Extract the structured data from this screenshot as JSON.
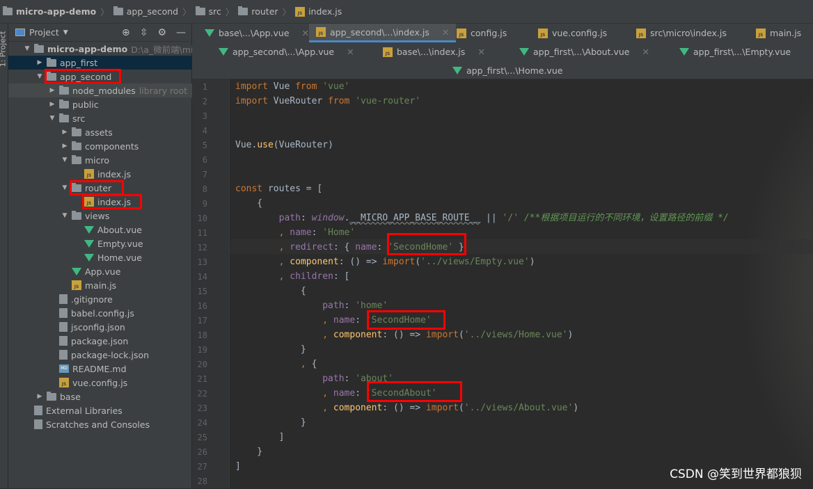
{
  "breadcrumb": [
    {
      "label": "micro-app-demo",
      "icon": "folder"
    },
    {
      "label": "app_second",
      "icon": "folder"
    },
    {
      "label": "src",
      "icon": "folder"
    },
    {
      "label": "router",
      "icon": "folder"
    },
    {
      "label": "index.js",
      "icon": "js"
    }
  ],
  "side_stripe": {
    "label": "1: Project"
  },
  "project_panel": {
    "title": "Project",
    "tools": [
      "crosshair-icon",
      "collapse-icon",
      "gear-icon",
      "minimize-icon"
    ]
  },
  "tree": [
    {
      "label": "micro-app-demo",
      "level": 0,
      "arrow": "down",
      "icon": "folder",
      "bold": true,
      "extra": "D:\\a_微前端\\micro-a"
    },
    {
      "label": "app_first",
      "level": 1,
      "arrow": "right",
      "icon": "folder",
      "selected": true
    },
    {
      "label": "app_second",
      "level": 1,
      "arrow": "down",
      "icon": "folder",
      "boxed": true
    },
    {
      "label": "node_modules",
      "level": 2,
      "arrow": "right",
      "icon": "folder",
      "extra": "library root",
      "highlight": true
    },
    {
      "label": "public",
      "level": 2,
      "arrow": "right",
      "icon": "folder"
    },
    {
      "label": "src",
      "level": 2,
      "arrow": "down",
      "icon": "folder"
    },
    {
      "label": "assets",
      "level": 3,
      "arrow": "right",
      "icon": "folder"
    },
    {
      "label": "components",
      "level": 3,
      "arrow": "right",
      "icon": "folder"
    },
    {
      "label": "micro",
      "level": 3,
      "arrow": "down",
      "icon": "folder"
    },
    {
      "label": "index.js",
      "level": 4,
      "icon": "js"
    },
    {
      "label": "router",
      "level": 3,
      "arrow": "down",
      "icon": "folder",
      "boxed": true
    },
    {
      "label": "index.js",
      "level": 4,
      "icon": "js",
      "boxed": true
    },
    {
      "label": "views",
      "level": 3,
      "arrow": "down",
      "icon": "folder"
    },
    {
      "label": "About.vue",
      "level": 4,
      "icon": "vue"
    },
    {
      "label": "Empty.vue",
      "level": 4,
      "icon": "vue"
    },
    {
      "label": "Home.vue",
      "level": 4,
      "icon": "vue"
    },
    {
      "label": "App.vue",
      "level": 3,
      "icon": "vue"
    },
    {
      "label": "main.js",
      "level": 3,
      "icon": "js"
    },
    {
      "label": ".gitignore",
      "level": 2,
      "icon": "file"
    },
    {
      "label": "babel.config.js",
      "level": 2,
      "icon": "file"
    },
    {
      "label": "jsconfig.json",
      "level": 2,
      "icon": "file"
    },
    {
      "label": "package.json",
      "level": 2,
      "icon": "file"
    },
    {
      "label": "package-lock.json",
      "level": 2,
      "icon": "file"
    },
    {
      "label": "README.md",
      "level": 2,
      "icon": "md"
    },
    {
      "label": "vue.config.js",
      "level": 2,
      "icon": "js"
    },
    {
      "label": "base",
      "level": 1,
      "arrow": "right",
      "icon": "folder"
    },
    {
      "label": "External Libraries",
      "level": 0,
      "icon": "libs"
    },
    {
      "label": "Scratches and Consoles",
      "level": 0,
      "icon": "scratch"
    }
  ],
  "tabs": [
    [
      {
        "label": "base\\...\\App.vue",
        "icon": "vue",
        "close": true
      },
      {
        "label": "app_second\\...\\index.js",
        "icon": "js",
        "close": true,
        "active": true
      },
      {
        "label": "config.js",
        "icon": "js"
      },
      {
        "label": "vue.config.js",
        "icon": "js"
      },
      {
        "label": "src\\micro\\index.js",
        "icon": "js"
      },
      {
        "label": "main.js",
        "icon": "js"
      }
    ],
    [
      {
        "label": "app_second\\...\\App.vue",
        "icon": "vue",
        "close": true
      },
      {
        "label": "base\\...\\index.js",
        "icon": "js",
        "close": true
      },
      {
        "label": "app_first\\...\\About.vue",
        "icon": "vue",
        "close": true
      },
      {
        "label": "app_first\\...\\Empty.vue",
        "icon": "vue"
      }
    ],
    [
      {
        "label": "app_first\\...\\Home.vue",
        "icon": "vue"
      }
    ]
  ],
  "code": [
    [
      [
        "kw",
        "import "
      ],
      [
        "pl",
        "Vue "
      ],
      [
        "kw",
        "from "
      ],
      [
        "str",
        "'vue'"
      ]
    ],
    [
      [
        "kw",
        "import "
      ],
      [
        "pl",
        "VueRouter "
      ],
      [
        "kw",
        "from "
      ],
      [
        "str",
        "'vue-router'"
      ]
    ],
    [],
    [],
    [
      [
        "pl",
        "Vue."
      ],
      [
        "fn",
        "use"
      ],
      [
        "pl",
        "(VueRouter)"
      ]
    ],
    [],
    [],
    [
      [
        "kw",
        "const "
      ],
      [
        "pl",
        "routes = ["
      ]
    ],
    [
      [
        "pl",
        "    {"
      ]
    ],
    [
      [
        "pl",
        "        "
      ],
      [
        "prop",
        "path"
      ],
      [
        "pl",
        ": "
      ],
      [
        "it",
        "window"
      ],
      [
        "pl",
        "."
      ],
      [
        "ul",
        "__MICRO_APP_BASE_ROUTE__"
      ],
      [
        "pl",
        " || "
      ],
      [
        "str",
        "'/'"
      ],
      [
        "com",
        " /**根据项目运行的不同环境，设置路径的前缀 */"
      ]
    ],
    [
      [
        "pl",
        "        "
      ],
      [
        "kw",
        ", "
      ],
      [
        "prop",
        "name"
      ],
      [
        "pl",
        ": "
      ],
      [
        "str",
        "'Home'"
      ]
    ],
    [
      [
        "pl",
        "        "
      ],
      [
        "kw",
        ", "
      ],
      [
        "prop",
        "redirect"
      ],
      [
        "pl",
        ": { "
      ],
      [
        "prop",
        "name"
      ],
      [
        "pl",
        ": "
      ],
      [
        "str",
        "'SecondHome'"
      ],
      [
        "pl",
        " }"
      ]
    ],
    [
      [
        "pl",
        "        "
      ],
      [
        "kw",
        ", "
      ],
      [
        "fn",
        "component"
      ],
      [
        "pl",
        ": () => "
      ],
      [
        "kw",
        "import"
      ],
      [
        "pl",
        "("
      ],
      [
        "str",
        "'../views/Empty.vue'"
      ],
      [
        "pl",
        ")"
      ]
    ],
    [
      [
        "pl",
        "        "
      ],
      [
        "kw",
        ", "
      ],
      [
        "prop",
        "children"
      ],
      [
        "pl",
        ": ["
      ]
    ],
    [
      [
        "pl",
        "            {"
      ]
    ],
    [
      [
        "pl",
        "                "
      ],
      [
        "prop",
        "path"
      ],
      [
        "pl",
        ": "
      ],
      [
        "str",
        "'home'"
      ]
    ],
    [
      [
        "pl",
        "                "
      ],
      [
        "kw",
        ", "
      ],
      [
        "prop",
        "name"
      ],
      [
        "pl",
        ": "
      ],
      [
        "str",
        "'SecondHome'"
      ]
    ],
    [
      [
        "pl",
        "                "
      ],
      [
        "kw",
        ", "
      ],
      [
        "fn",
        "component"
      ],
      [
        "pl",
        ": () => "
      ],
      [
        "kw",
        "import"
      ],
      [
        "pl",
        "("
      ],
      [
        "str",
        "'../views/Home.vue'"
      ],
      [
        "pl",
        ")"
      ]
    ],
    [
      [
        "pl",
        "            }"
      ]
    ],
    [
      [
        "pl",
        "            "
      ],
      [
        "kw",
        ", "
      ],
      [
        "pl",
        "{"
      ]
    ],
    [
      [
        "pl",
        "                "
      ],
      [
        "prop",
        "path"
      ],
      [
        "pl",
        ": "
      ],
      [
        "str",
        "'about'"
      ]
    ],
    [
      [
        "pl",
        "                "
      ],
      [
        "kw",
        ", "
      ],
      [
        "prop",
        "name"
      ],
      [
        "pl",
        ": "
      ],
      [
        "str",
        "'SecondAbout'"
      ]
    ],
    [
      [
        "pl",
        "                "
      ],
      [
        "kw",
        ", "
      ],
      [
        "fn",
        "component"
      ],
      [
        "pl",
        ": () => "
      ],
      [
        "kw",
        "import"
      ],
      [
        "pl",
        "("
      ],
      [
        "str",
        "'../views/About.vue'"
      ],
      [
        "pl",
        ")"
      ]
    ],
    [
      [
        "pl",
        "            }"
      ]
    ],
    [
      [
        "pl",
        "        ]"
      ]
    ],
    [
      [
        "pl",
        "    }"
      ]
    ],
    [
      [
        "pl",
        "]"
      ]
    ],
    []
  ],
  "watermark": "CSDN @笑到世界都狼狈",
  "colors": {
    "highlight_box": "#ff0000",
    "editor_bg": "#2b2b2b",
    "panel_bg": "#3c3f41",
    "selection": "#0d293e"
  }
}
